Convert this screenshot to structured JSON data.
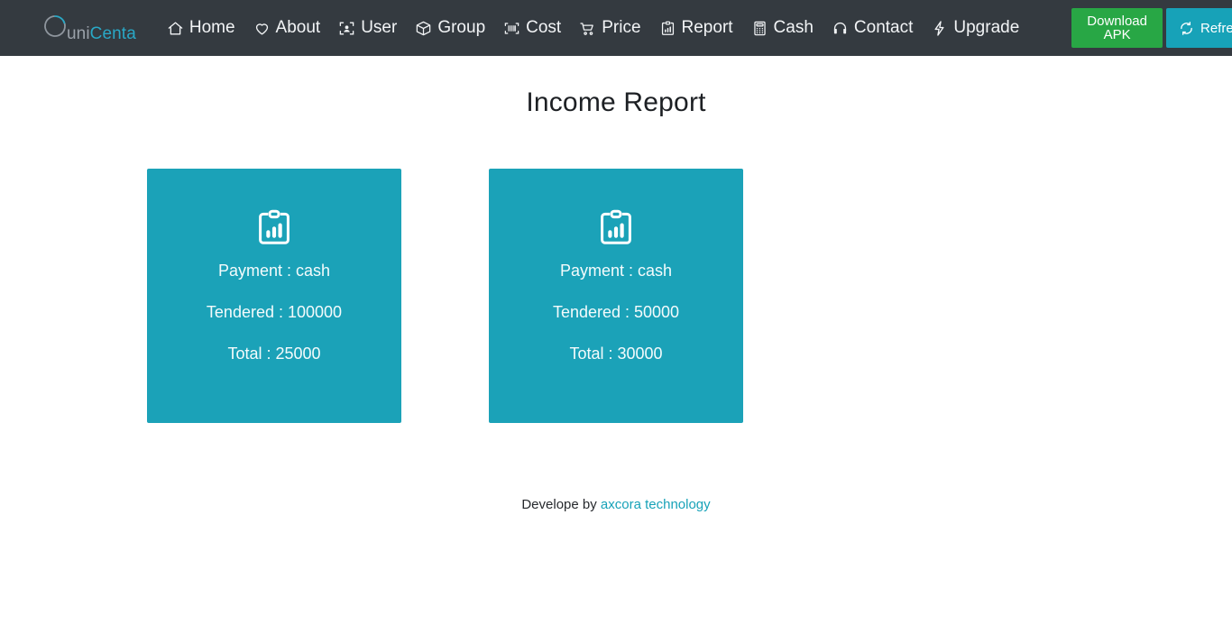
{
  "navbar": {
    "brand": {
      "prefix": "uni",
      "suffix": "Centa",
      "icon": "circle-logo-icon"
    },
    "items": [
      {
        "label": "Home",
        "icon": "home-icon"
      },
      {
        "label": "About",
        "icon": "heart-icon"
      },
      {
        "label": "User",
        "icon": "user-card-icon"
      },
      {
        "label": "Group",
        "icon": "box-icon"
      },
      {
        "label": "Cost",
        "icon": "barcode-icon"
      },
      {
        "label": "Price",
        "icon": "shopping-cart-icon"
      },
      {
        "label": "Report",
        "icon": "chart-clipboard-icon"
      },
      {
        "label": "Cash",
        "icon": "calculator-icon"
      },
      {
        "label": "Contact",
        "icon": "headset-icon"
      },
      {
        "label": "Upgrade",
        "icon": "lightning-bolt-icon"
      }
    ],
    "download_button": {
      "label": "Download APK",
      "color": "#28a745"
    },
    "refresh_button": {
      "label": "Refresh",
      "icon": "refresh-icon",
      "color": "#17a2b8"
    },
    "background": "#343a40"
  },
  "main": {
    "title": "Income Report",
    "card_color": "#1ba2b8",
    "cards": [
      {
        "icon": "chart-clipboard-icon",
        "payment": "Payment : cash",
        "tendered": "Tendered : 100000",
        "total": "Total : 25000"
      },
      {
        "icon": "chart-clipboard-icon",
        "payment": "Payment : cash",
        "tendered": "Tendered : 50000",
        "total": "Total : 30000"
      }
    ]
  },
  "footer": {
    "text": "Develope by",
    "link_label": "axcora technology",
    "link_color": "#17a2b8"
  }
}
